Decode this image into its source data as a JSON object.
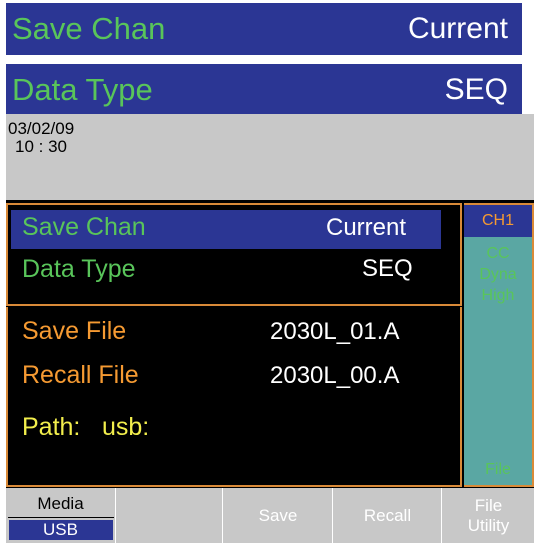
{
  "zoom": {
    "row1": {
      "label": "Save Chan",
      "value": "Current"
    },
    "row2": {
      "label": "Data Type",
      "value": "SEQ"
    }
  },
  "screen": {
    "date": "03/02/09",
    "time": "10 : 30",
    "panel_top": {
      "save_chan": {
        "label": "Save Chan",
        "value": "Current"
      },
      "data_type": {
        "label": "Data Type",
        "value": "SEQ"
      }
    },
    "panel_bottom": {
      "save_file": {
        "label": "Save File",
        "value": "2030L_01.A"
      },
      "recall_file": {
        "label": "Recall File",
        "value": "2030L_00.A"
      },
      "path": {
        "label": "Path:",
        "value": "usb:"
      }
    },
    "side": {
      "channel": "CH1",
      "mode": "CC",
      "range1": "Dyna",
      "range2": "High",
      "footer": "File"
    },
    "softkeys": {
      "media_label": "Media",
      "media_value": "USB",
      "key2": "",
      "save": "Save",
      "recall": "Recall",
      "file_utility_line1": "File",
      "file_utility_line2": "Utility"
    }
  },
  "colors": {
    "blue": "#2b3694",
    "green": "#59c55a",
    "orange": "#f59a32",
    "yellow": "#f2ee4c",
    "teal": "#5aa7a3",
    "gray": "#c8c8c8"
  }
}
